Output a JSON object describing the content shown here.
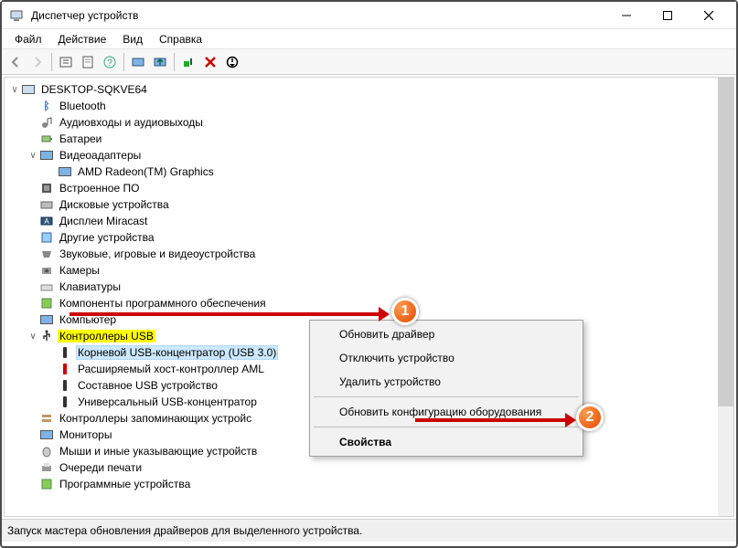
{
  "window": {
    "title": "Диспетчер устройств"
  },
  "menu": {
    "file": "Файл",
    "action": "Действие",
    "view": "Вид",
    "help": "Справка"
  },
  "tree": {
    "root": "DESKTOP-SQKVE64",
    "items": [
      {
        "icon": "bluetooth",
        "label": "Bluetooth"
      },
      {
        "icon": "audio",
        "label": "Аудиовходы и аудиовыходы"
      },
      {
        "icon": "battery",
        "label": "Батареи"
      },
      {
        "icon": "display",
        "label": "Видеоадаптеры",
        "expanded": true,
        "children": [
          {
            "icon": "monitor",
            "label": "AMD Radeon(TM) Graphics"
          }
        ]
      },
      {
        "icon": "firmware",
        "label": "Встроенное ПО"
      },
      {
        "icon": "disk",
        "label": "Дисковые устройства"
      },
      {
        "icon": "miracast",
        "label": "Дисплеи Miracast"
      },
      {
        "icon": "other",
        "label": "Другие устройства"
      },
      {
        "icon": "game",
        "label": "Звуковые, игровые и видеоустройства"
      },
      {
        "icon": "camera",
        "label": "Камеры"
      },
      {
        "icon": "keyboard",
        "label": "Клавиатуры"
      },
      {
        "icon": "software",
        "label": "Компоненты программного обеспечения"
      },
      {
        "icon": "computer-small",
        "label": "Компьютер"
      },
      {
        "icon": "usb-ctrl",
        "label": "Контроллеры USB",
        "expanded": true,
        "highlight": true,
        "children": [
          {
            "icon": "usb",
            "label": "Корневой USB-концентратор (USB 3.0)",
            "selected": true
          },
          {
            "icon": "usb-red",
            "label": "Расширяемый хост-контроллер AML"
          },
          {
            "icon": "usb",
            "label": "Составное USB устройство"
          },
          {
            "icon": "usb",
            "label": "Универсальный USB-концентратор"
          }
        ]
      },
      {
        "icon": "storage",
        "label": "Контроллеры запоминающих устройс"
      },
      {
        "icon": "monitor",
        "label": "Мониторы"
      },
      {
        "icon": "mouse",
        "label": "Мыши и иные указывающие устройств"
      },
      {
        "icon": "printer",
        "label": "Очереди печати"
      },
      {
        "icon": "software2",
        "label": "Программные устройства"
      }
    ]
  },
  "context_menu": {
    "update_driver": "Обновить драйвер",
    "disable": "Отключить устройство",
    "uninstall": "Удалить устройство",
    "scan": "Обновить конфигурацию оборудования",
    "properties": "Свойства"
  },
  "badges": {
    "one": "1",
    "two": "2"
  },
  "status": "Запуск мастера обновления драйверов для выделенного устройства."
}
